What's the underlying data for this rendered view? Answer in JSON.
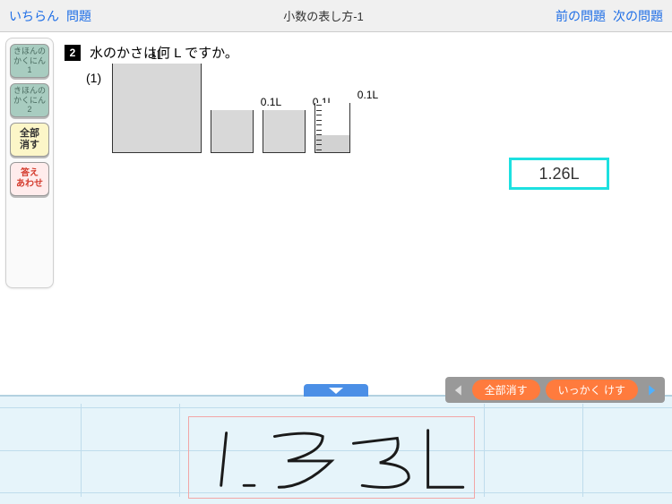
{
  "topbar": {
    "list": "いちらん",
    "question": "問題",
    "title": "小数の表し方-1",
    "prev": "前の問題",
    "next": "次の問題"
  },
  "sidebar": {
    "btn1": "きほんの\nかくにん1",
    "btn2": "きほんの\nかくにん2",
    "btn3": "全部\n消す",
    "btn4": "答え\nあわせ"
  },
  "problem": {
    "number": "2",
    "text": "水のかさは何 L ですか。",
    "sub": "(1)",
    "labels": {
      "large": "1L",
      "small": "0.1L",
      "beaker": "0.1L"
    }
  },
  "answer": {
    "value": "1.26L"
  },
  "handwrite": {
    "clear_all": "全部消す",
    "erase_one": "いっかく けす"
  }
}
